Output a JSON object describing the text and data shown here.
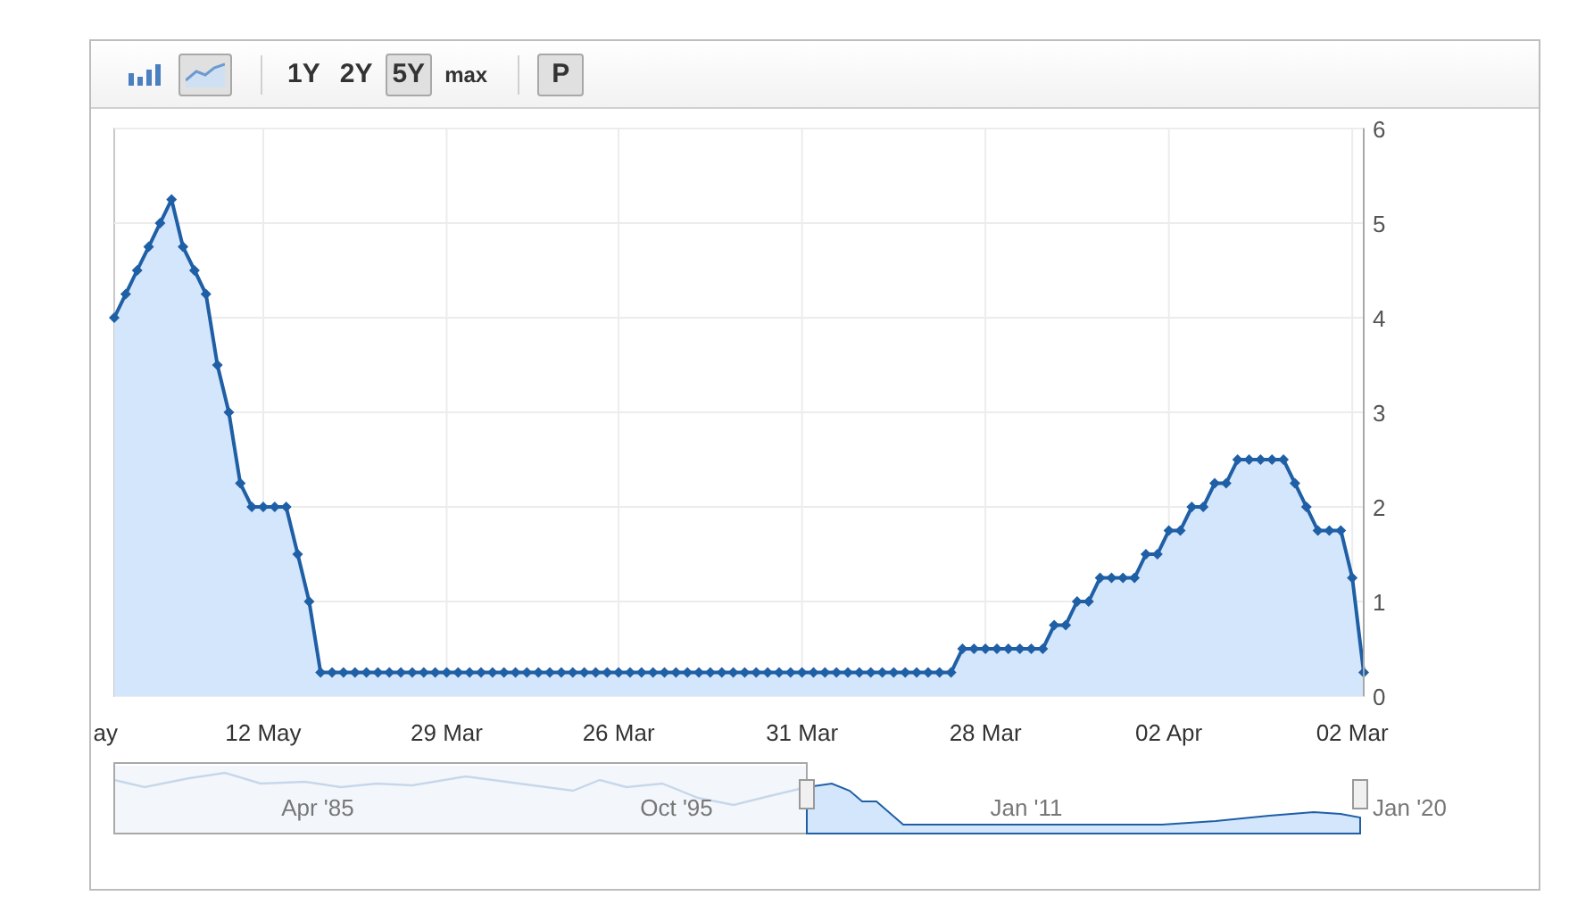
{
  "toolbar": {
    "chart_types": [
      {
        "kind": "bar",
        "selected": false
      },
      {
        "kind": "line",
        "selected": true
      }
    ],
    "ranges": [
      {
        "label": "1Y",
        "selected": false
      },
      {
        "label": "2Y",
        "selected": false
      },
      {
        "label": "5Y",
        "selected": true
      },
      {
        "label": "max",
        "selected": false
      }
    ],
    "p_button": {
      "label": "P",
      "selected": true
    }
  },
  "chart": {
    "cut_axis_label": "ay",
    "chart_data": {
      "type": "area",
      "grid": true,
      "ylim": [
        0,
        6
      ],
      "yticks": [
        0,
        1,
        2,
        3,
        4,
        5,
        6
      ],
      "categories": [
        null,
        null,
        null,
        null,
        null,
        null,
        null,
        null,
        null,
        null,
        null,
        null,
        null,
        "12 May",
        null,
        null,
        null,
        null,
        null,
        null,
        null,
        null,
        null,
        null,
        null,
        null,
        null,
        null,
        null,
        "29 Mar",
        null,
        null,
        null,
        null,
        null,
        null,
        null,
        null,
        null,
        null,
        null,
        null,
        null,
        null,
        "26 Mar",
        null,
        null,
        null,
        null,
        null,
        null,
        null,
        null,
        null,
        null,
        null,
        null,
        null,
        null,
        null,
        "31 Mar",
        null,
        null,
        null,
        null,
        null,
        null,
        null,
        null,
        null,
        null,
        null,
        null,
        null,
        null,
        null,
        "28 Mar",
        null,
        null,
        null,
        null,
        null,
        null,
        null,
        null,
        null,
        null,
        null,
        null,
        null,
        null,
        null,
        "02 Apr",
        null,
        null,
        null,
        null,
        null,
        null,
        null,
        null,
        null,
        null,
        null,
        null,
        null,
        null,
        null,
        "02 Mar",
        null
      ],
      "series": [
        {
          "color": "#1f5fa6",
          "values": [
            4,
            4.25,
            4.5,
            4.75,
            5,
            5.25,
            4.75,
            4.5,
            4.25,
            3.5,
            3,
            2.25,
            2,
            2,
            2,
            2,
            1.5,
            1,
            0.25,
            0.25,
            0.25,
            0.25,
            0.25,
            0.25,
            0.25,
            0.25,
            0.25,
            0.25,
            0.25,
            0.25,
            0.25,
            0.25,
            0.25,
            0.25,
            0.25,
            0.25,
            0.25,
            0.25,
            0.25,
            0.25,
            0.25,
            0.25,
            0.25,
            0.25,
            0.25,
            0.25,
            0.25,
            0.25,
            0.25,
            0.25,
            0.25,
            0.25,
            0.25,
            0.25,
            0.25,
            0.25,
            0.25,
            0.25,
            0.25,
            0.25,
            0.25,
            0.25,
            0.25,
            0.25,
            0.25,
            0.25,
            0.25,
            0.25,
            0.25,
            0.25,
            0.25,
            0.25,
            0.25,
            0.25,
            0.5,
            0.5,
            0.5,
            0.5,
            0.5,
            0.5,
            0.5,
            0.5,
            0.75,
            0.75,
            1,
            1,
            1.25,
            1.25,
            1.25,
            1.25,
            1.5,
            1.5,
            1.75,
            1.75,
            2,
            2,
            2.25,
            2.25,
            2.5,
            2.5,
            2.5,
            2.5,
            2.5,
            2.25,
            2,
            1.75,
            1.75,
            1.75,
            1.25,
            0.25
          ]
        }
      ]
    }
  },
  "navigator": {
    "labels": [
      "Apr '85",
      "Oct '95",
      "Jan '11",
      "Jan '20"
    ]
  }
}
